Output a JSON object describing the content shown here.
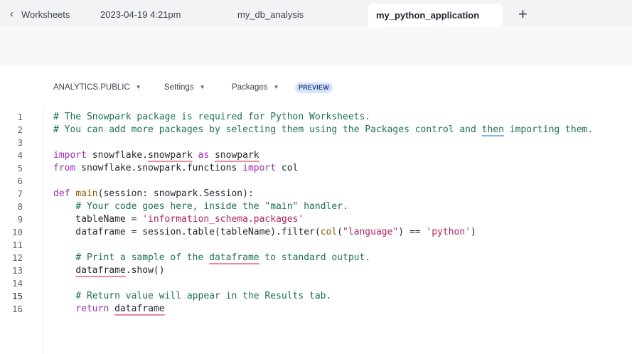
{
  "tabs": {
    "back_label": "Worksheets",
    "date_label": "2023-04-19 4:21pm",
    "db_tab": "my_db_analysis",
    "active_tab": "my_python_application",
    "add_label": "+"
  },
  "context": {
    "database": "ANALYTICS.PUBLIC",
    "settings": "Settings",
    "packages": "Packages",
    "badge": "PREVIEW"
  },
  "editor": {
    "line_numbers": [
      "1",
      "2",
      "3",
      "4",
      "5",
      "6",
      "7",
      "8",
      "9",
      "10",
      "11",
      "12",
      "13",
      "14",
      "15",
      "16"
    ],
    "current_line": 15,
    "lines": [
      [
        {
          "t": "cm",
          "v": "# The Snowpark package is required for Python Worksheets."
        }
      ],
      [
        {
          "t": "cm",
          "v": "# You can add more packages by selecting them using the Packages control and "
        },
        {
          "t": "cm",
          "u": "blue",
          "v": "then"
        },
        {
          "t": "cm",
          "v": " importing them."
        }
      ],
      [],
      [
        {
          "t": "kw",
          "v": "import"
        },
        {
          "t": "",
          "v": " snowflake."
        },
        {
          "t": "",
          "u": "red",
          "v": "snowpark"
        },
        {
          "t": "",
          "v": " "
        },
        {
          "t": "kw",
          "v": "as"
        },
        {
          "t": "",
          "v": " "
        },
        {
          "t": "",
          "u": "red",
          "v": "snowpark"
        }
      ],
      [
        {
          "t": "kw",
          "v": "from"
        },
        {
          "t": "",
          "v": " snowflake.snowpark.functions "
        },
        {
          "t": "kw",
          "v": "import"
        },
        {
          "t": "",
          "v": " col"
        }
      ],
      [],
      [
        {
          "t": "kw",
          "v": "def"
        },
        {
          "t": "",
          "v": " "
        },
        {
          "t": "fn",
          "v": "main"
        },
        {
          "t": "",
          "v": "(session: snowpark.Session):"
        }
      ],
      [
        {
          "t": "",
          "v": "    "
        },
        {
          "t": "cm",
          "v": "# Your code goes here, inside the \"main\" handler."
        }
      ],
      [
        {
          "t": "",
          "v": "    tableName = "
        },
        {
          "t": "st",
          "v": "'information_schema.packages'"
        }
      ],
      [
        {
          "t": "",
          "v": "    dataframe = session.table(tableName).filter("
        },
        {
          "t": "fn",
          "v": "col"
        },
        {
          "t": "",
          "v": "("
        },
        {
          "t": "st",
          "v": "\"language\""
        },
        {
          "t": "",
          "v": ") == "
        },
        {
          "t": "st",
          "v": "'python'"
        },
        {
          "t": "",
          "v": ")"
        }
      ],
      [],
      [
        {
          "t": "",
          "v": "    "
        },
        {
          "t": "cm",
          "v": "# Print a sample of the "
        },
        {
          "t": "cm",
          "u": "red",
          "v": "dataframe"
        },
        {
          "t": "cm",
          "v": " to standard output."
        }
      ],
      [
        {
          "t": "",
          "v": "    "
        },
        {
          "t": "",
          "u": "red",
          "v": "dataframe"
        },
        {
          "t": "",
          "v": ".show()"
        }
      ],
      [],
      [
        {
          "t": "",
          "v": "    "
        },
        {
          "t": "cm",
          "v": "# Return value will appear in the Results tab."
        }
      ],
      [
        {
          "t": "",
          "v": "    "
        },
        {
          "t": "kw",
          "v": "return"
        },
        {
          "t": "",
          "v": " "
        },
        {
          "t": "",
          "u": "red",
          "v": "dataframe"
        }
      ]
    ]
  }
}
